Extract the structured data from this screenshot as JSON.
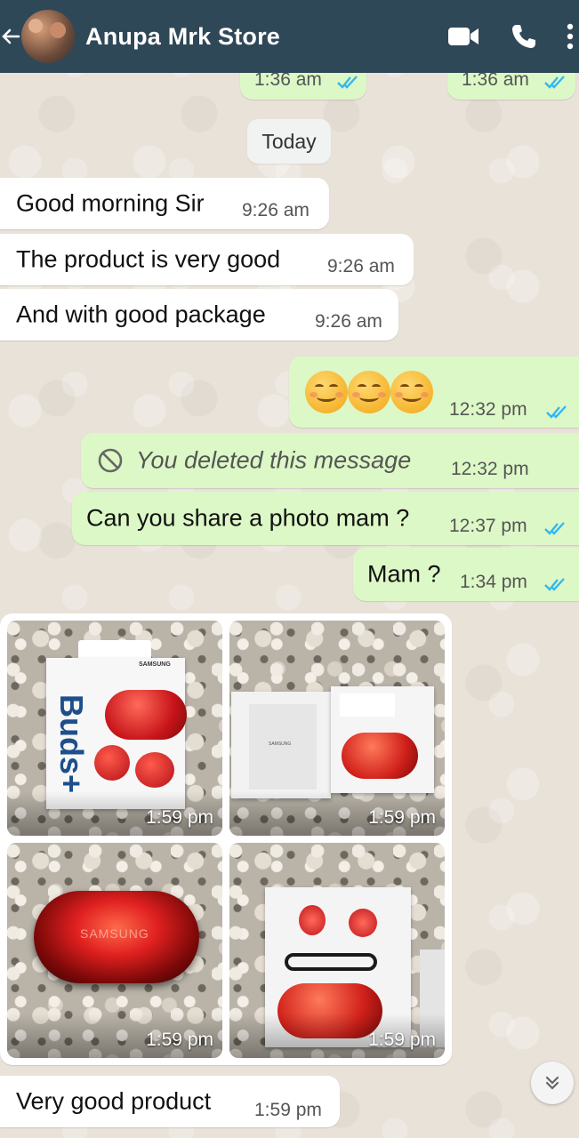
{
  "header": {
    "contact_name": "Anupa Mrk Store",
    "icons": [
      "back-arrow-icon",
      "video-call-icon",
      "phone-icon",
      "more-vert-icon"
    ],
    "bg_color": "#2f4858"
  },
  "top_partial": {
    "left_time": "1:36 am",
    "right_time": "1:36 am"
  },
  "date_divider": "Today",
  "messages": [
    {
      "dir": "in",
      "text": "Good morning Sir",
      "time": "9:26 am"
    },
    {
      "dir": "in",
      "text": "The product is very good",
      "time": "9:26 am"
    },
    {
      "dir": "in",
      "text": "And with good package",
      "time": "9:26 am"
    },
    {
      "dir": "out",
      "text": "😊😊😊",
      "time": "12:32 pm",
      "status": "read"
    },
    {
      "dir": "out",
      "text": "You deleted this message",
      "time": "12:32 pm",
      "deleted": true
    },
    {
      "dir": "out",
      "text": "Can you share a photo mam ?",
      "time": "12:37 pm",
      "status": "read"
    },
    {
      "dir": "out",
      "text": "Mam ?",
      "time": "1:34 pm",
      "status": "read"
    },
    {
      "dir": "in",
      "text": "Very good product",
      "time": "1:59 pm"
    }
  ],
  "photos": [
    {
      "time": "1:59 pm",
      "subject": "Samsung Buds+ box",
      "box_brand": "SAMSUNG",
      "box_title": "Buds+"
    },
    {
      "time": "1:59 pm",
      "subject": "opened box with red case",
      "box_brand": "SAMSUNG"
    },
    {
      "time": "1:59 pm",
      "subject": "red earbuds case closeup",
      "case_brand": "SAMSUNG"
    },
    {
      "time": "1:59 pm",
      "subject": "earbuds, cable and case in box"
    }
  ],
  "colors": {
    "incoming_bubble": "#ffffff",
    "outgoing_bubble": "#dcf8c6",
    "read_tick": "#34b7f1"
  }
}
